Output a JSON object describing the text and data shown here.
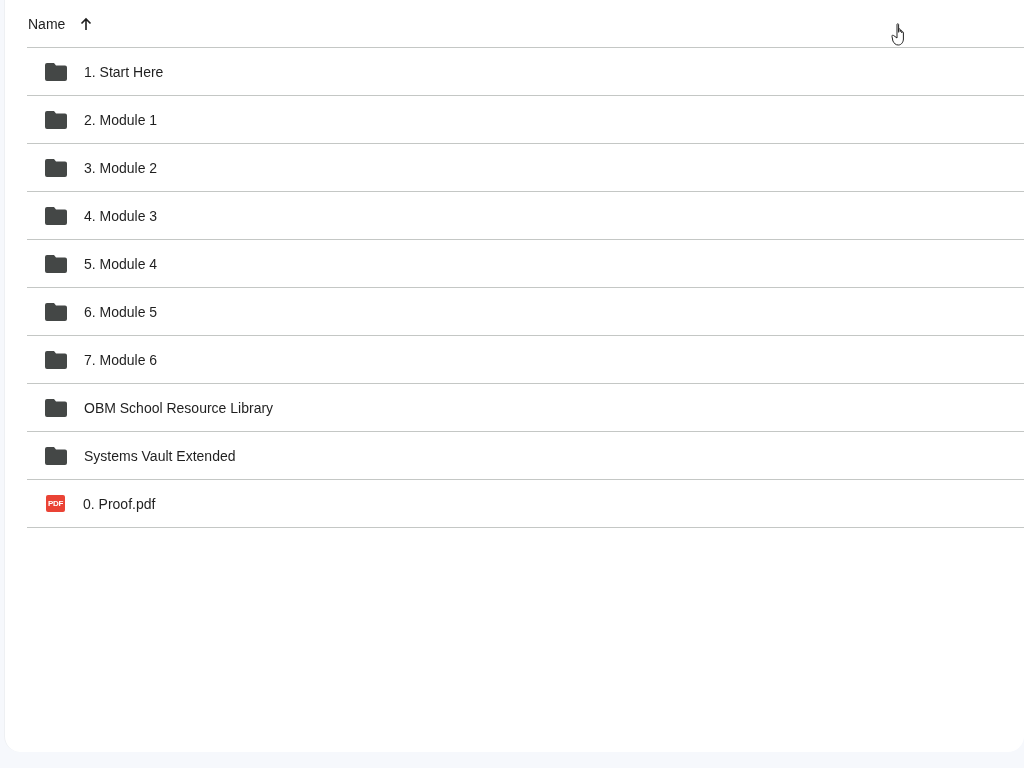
{
  "table": {
    "columns": [
      {
        "label": "Name",
        "ascending": true
      }
    ],
    "rows": [
      {
        "kind": "folder",
        "name": "1. Start Here"
      },
      {
        "kind": "folder",
        "name": "2. Module 1"
      },
      {
        "kind": "folder",
        "name": "3. Module 2"
      },
      {
        "kind": "folder",
        "name": "4. Module 3"
      },
      {
        "kind": "folder",
        "name": "5. Module 4"
      },
      {
        "kind": "folder",
        "name": "6. Module 5"
      },
      {
        "kind": "folder",
        "name": "7. Module 6"
      },
      {
        "kind": "folder",
        "name": "OBM School Resource Library"
      },
      {
        "kind": "folder",
        "name": "Systems Vault Extended"
      },
      {
        "kind": "pdf",
        "name": "0. Proof.pdf",
        "icon_label": "PDF"
      }
    ]
  }
}
